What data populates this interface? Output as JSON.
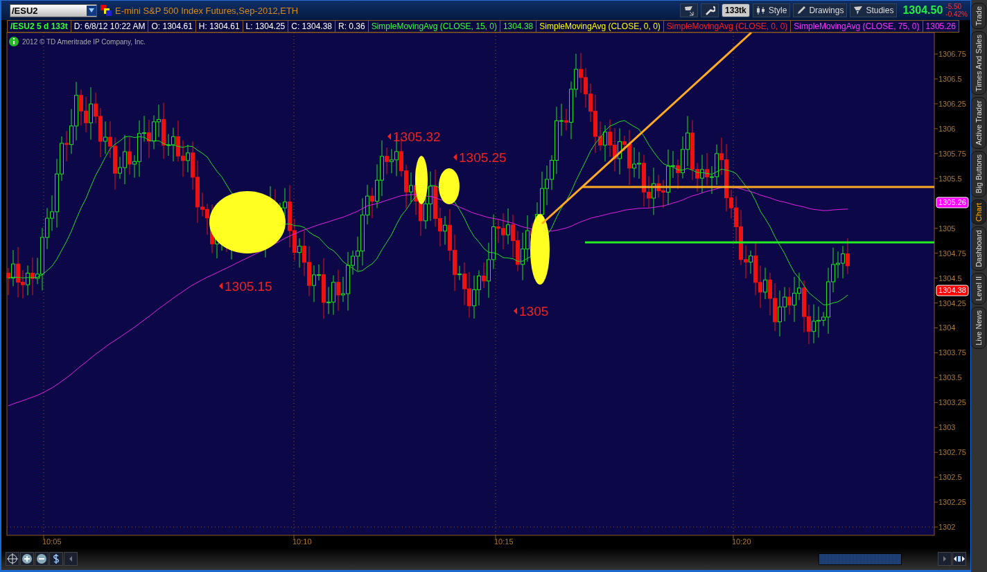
{
  "symbol_field": {
    "value": "/ESU2"
  },
  "instrument_title": "E-mini S&P 500 Index Futures,Sep-2012,ETH",
  "toolbar": {
    "buttons": [
      {
        "label": "133tk",
        "kind": "badge"
      },
      {
        "label": "Style",
        "kind": "candles"
      },
      {
        "label": "Drawings",
        "kind": "pencil"
      },
      {
        "label": "Studies",
        "kind": "flask"
      }
    ]
  },
  "quote": {
    "last": "1304.50",
    "change": "-5.50",
    "change_percent": "-0.42%"
  },
  "info_strip": [
    {
      "text": "/ESU2 5 d 133t",
      "color": "#33ff33"
    },
    {
      "text": "D: 6/8/12 10:22 AM",
      "color": "#ffffff"
    },
    {
      "text": "O: 1304.61",
      "color": "#ffffff"
    },
    {
      "text": "H: 1304.61",
      "color": "#ffffff"
    },
    {
      "text": "L: 1304.25",
      "color": "#ffffff"
    },
    {
      "text": "C: 1304.38",
      "color": "#ffffff"
    },
    {
      "text": "R: 0.36",
      "color": "#ffffff"
    },
    {
      "text": "SimpleMovingAvg (CLOSE, 15, 0)",
      "color": "#33ff33"
    },
    {
      "text": "1304.38",
      "color": "#33ff33"
    },
    {
      "text": "SimpleMovingAvg (CLOSE, 0, 0)",
      "color": "#ffff00"
    },
    {
      "text": "SimpleMovingAvg (CLOSE, 0, 0)",
      "color": "#ff2020"
    },
    {
      "text": "SimpleMovingAvg (CLOSE, 75, 0)",
      "color": "#ff33ff"
    },
    {
      "text": "1305.26",
      "color": "#ff33ff"
    }
  ],
  "copyright": "2012 © TD Ameritrade IP Company, Inc.",
  "chart": {
    "y_ticks": [
      "1306.75",
      "1306.5",
      "1306.25",
      "1306",
      "1305.75",
      "1305.5",
      "1305",
      "1304.75",
      "1304.5",
      "1304.25",
      "1304",
      "1303.75",
      "1303.5",
      "1303.25",
      "1303",
      "1302.75",
      "1302.5",
      "1302.25",
      "1302"
    ],
    "x_ticks": [
      "10:05",
      "10:10",
      "10:15",
      "10:20"
    ],
    "annotations": [
      "1305.32",
      "1305.25",
      "1305.15",
      "1305"
    ],
    "price_labels": [
      {
        "text": "1305.26",
        "color": "#ff00ff"
      },
      {
        "text": "1304.38",
        "color": "#ff0000"
      }
    ]
  },
  "side_tabs": [
    {
      "label": "Trade",
      "selected": false
    },
    {
      "label": "Times And Sales",
      "selected": false
    },
    {
      "label": "Active Trader",
      "selected": false
    },
    {
      "label": "Big Buttons",
      "selected": false
    },
    {
      "label": "Chart",
      "selected": true
    },
    {
      "label": "Dashboard",
      "selected": false
    },
    {
      "label": "Level II",
      "selected": false
    },
    {
      "label": "Live News",
      "selected": false
    }
  ]
}
